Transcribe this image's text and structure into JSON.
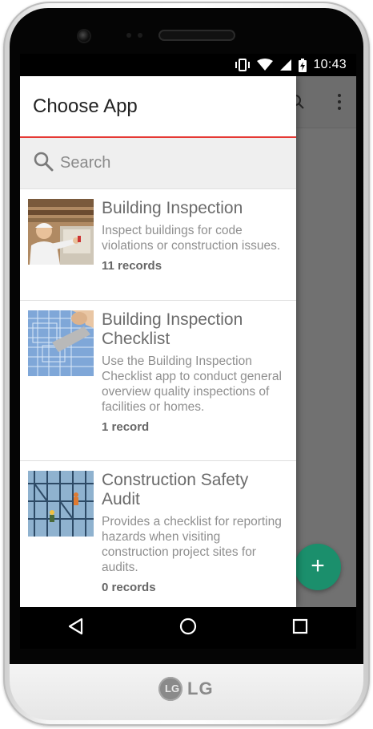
{
  "status_bar": {
    "time": "10:43",
    "icons": [
      "vibrate-icon",
      "wifi-icon",
      "battery-charging-icon"
    ]
  },
  "drawer": {
    "title": "Choose App",
    "search_placeholder": "Search",
    "apps": [
      {
        "name": "Building Inspection",
        "description": "Inspect buildings for code violations or construction issues.",
        "records": "11 records"
      },
      {
        "name": "Building Inspection Checklist",
        "description": "Use the Building Inspection Checklist app to conduct general overview quality inspections of facilities or homes.",
        "records": "1 record"
      },
      {
        "name": "Construction Safety Audit",
        "description": "Provides a checklist for reporting hazards when visiting construction project sites for audits.",
        "records": "0 records"
      }
    ]
  },
  "fab": {
    "label": "+"
  },
  "nav_bar": {
    "icons": [
      "back-icon",
      "home-icon",
      "recents-icon"
    ]
  },
  "brand": {
    "logo_text": "LG",
    "logo_mark": "LG"
  },
  "colors": {
    "accent_red": "#e53935",
    "fab_green": "#1b8f6c",
    "drawer_bg": "#ffffff",
    "search_bg": "#efefef"
  }
}
